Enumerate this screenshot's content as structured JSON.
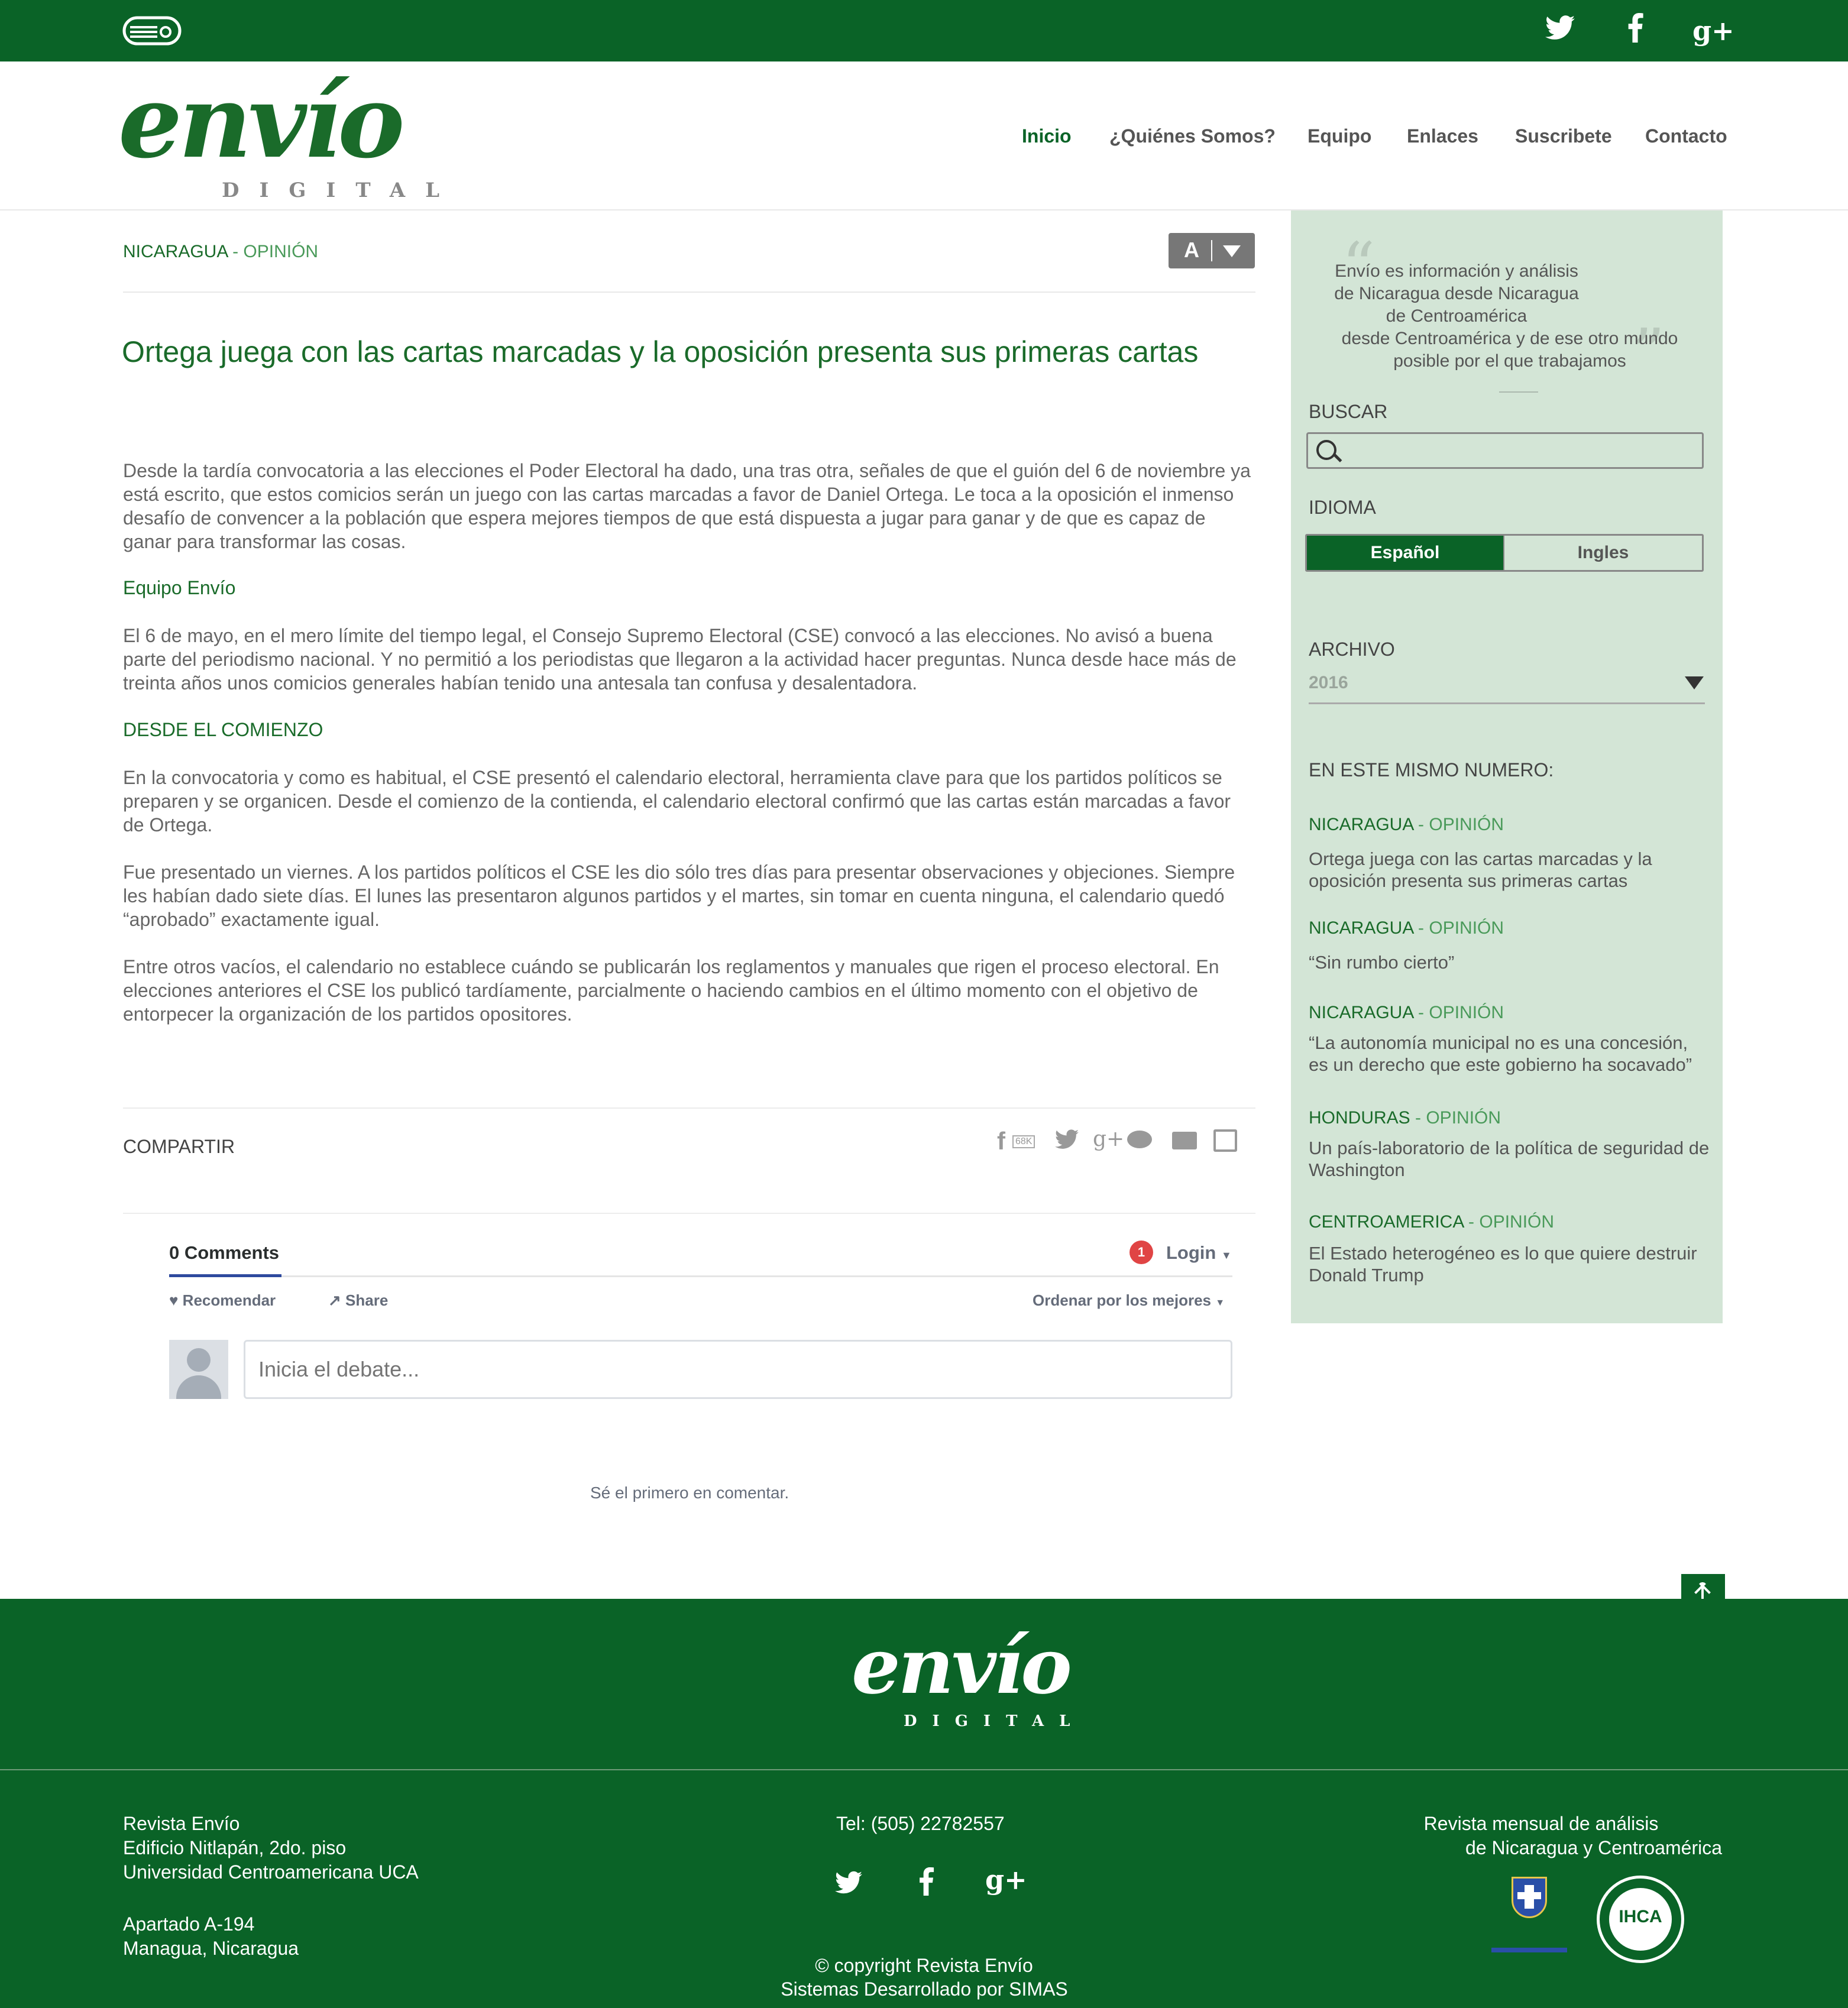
{
  "top_bar": {
    "social": {
      "twitter": "twitter-icon",
      "facebook": "facebook-icon",
      "googleplus": "google-plus-icon"
    }
  },
  "logo": {
    "script": "envío",
    "sub": "DIGITAL"
  },
  "nav": [
    "Inicio",
    "¿Quiénes Somos?",
    "Equipo",
    "Enlaces",
    "Suscribete",
    "Contacto"
  ],
  "article": {
    "category": "NICARAGUA",
    "subcategory": "- OPINIÓN",
    "font_control": "A",
    "title": "Ortega juega con las cartas marcadas y la oposición presenta sus primeras cartas",
    "intro": "Desde la tardía convocatoria a las elecciones el Poder Electoral ha dado, una tras otra, señales de que el guión del 6 de noviembre ya está escrito, que estos comicios serán un juego con las cartas marcadas a favor de Daniel Ortega. Le toca a la oposición el inmenso desafío de convencer a la población que espera mejores tiempos de que está dispuesta a jugar para ganar y de que es capaz de ganar para transformar las cosas.",
    "author": "Equipo Envío",
    "p1": "El 6 de mayo, en el mero límite del tiempo legal, el Consejo Supremo Electoral (CSE) convocó a las elecciones. No avisó a buena parte del periodismo nacional. Y no permitió a los periodistas que llegaron a la actividad hacer preguntas. Nunca desde hace más de treinta años unos comicios generales habían tenido una antesala tan confusa y desalentadora.",
    "section": "DESDE EL COMIENZO",
    "p2": "En la convocatoria y como es habitual, el CSE presentó el calendario electoral, herramienta clave para que los partidos políticos se preparen y se organicen. Desde el comienzo de la contienda, el calendario electoral confirmó que las cartas están marcadas a favor de Ortega.",
    "p3": "Fue presentado un viernes. A los partidos políticos el CSE les dio sólo tres días para presentar observaciones y objeciones. Siempre les habían dado siete días. El lunes las presentaron algunos partidos y el martes, sin tomar en cuenta ninguna, el calendario quedó “aprobado” exactamente igual.",
    "p4": "Entre otros vacíos, el calendario no establece cuándo se publicarán los reglamentos y manuales que rigen el proceso electoral. En elecciones anteriores el CSE los publicó tardíamente, parcialmente o haciendo cambios en el último momento con el objetivo de entorpecer la organización de los partidos opositores."
  },
  "share": {
    "label": "COMPARTIR",
    "fb_count": "68K"
  },
  "comments": {
    "count_label": "0 Comments",
    "badge": "1",
    "login": "Login",
    "recommend": "Recomendar",
    "share": "Share",
    "sort": "Ordenar por los mejores",
    "placeholder": "Inicia el debate...",
    "first": "Sé el primero en comentar."
  },
  "sidebar": {
    "quote": [
      "Envío es información y análisis",
      "de  Nicaragua desde Nicaragua",
      "de Centroamérica",
      "desde Centroamérica y de ese otro mundo",
      "posible por el que trabajamos"
    ],
    "search_label": "BUSCAR",
    "language_label": "IDIOMA",
    "lang_es": "Español",
    "lang_en": "Ingles",
    "archive_label": "ARCHIVO",
    "archive_value": "2016",
    "same_issue_label": "EN ESTE MISMO NUMERO:",
    "items": [
      {
        "cat": "NICARAGUA",
        "sub": " - OPINIÓN",
        "title": "Ortega juega con las cartas marcadas y la oposición presenta sus primeras cartas"
      },
      {
        "cat": "NICARAGUA",
        "sub": " - OPINIÓN",
        "title": "“Sin rumbo cierto”"
      },
      {
        "cat": "NICARAGUA",
        "sub": " - OPINIÓN",
        "title": "“La autonomía municipal no es una concesión, es un derecho que este gobierno ha socavado”"
      },
      {
        "cat": "HONDURAS",
        "sub": " - OPINIÓN",
        "title": "Un país-laboratorio de la política de seguridad de Washington"
      },
      {
        "cat": "CENTROAMERICA",
        "sub": " - OPINIÓN",
        "title": "El Estado heterogéneo es lo que quiere destruir Donald Trump"
      }
    ]
  },
  "footer": {
    "address": [
      "Revista Envío",
      "Edificio Nitlapán, 2do. piso",
      "Universidad Centroamericana UCA"
    ],
    "postal": [
      "Apartado A-194",
      "Managua, Nicaragua"
    ],
    "phone": "Tel: (505) 22782557",
    "tagline": [
      "Revista mensual de análisis",
      "de Nicaragua y Centroamérica"
    ],
    "copyright": "© copyright Revista Envío",
    "developer": "Sistemas Desarrollado por SIMAS",
    "ihca": "IHCA"
  },
  "colors": {
    "brand_green": "#0a6327",
    "sidebar_bg": "#d3e5d6",
    "link_green": "#1a6b2a"
  }
}
